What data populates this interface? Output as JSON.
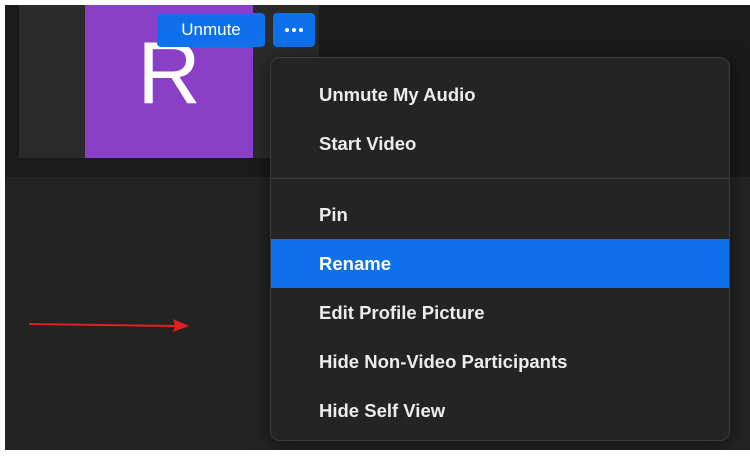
{
  "participant": {
    "initial": "R",
    "avatar_color": "#8a3fc7"
  },
  "toolbar": {
    "unmute_label": "Unmute",
    "more_icon": "more-horizontal-icon"
  },
  "context_menu": {
    "group1": [
      {
        "label": "Unmute My Audio"
      },
      {
        "label": "Start Video"
      }
    ],
    "group2": [
      {
        "label": "Pin"
      },
      {
        "label": "Rename",
        "highlighted": true
      },
      {
        "label": "Edit Profile Picture"
      },
      {
        "label": "Hide Non-Video Participants"
      },
      {
        "label": "Hide Self View"
      }
    ]
  },
  "annotation": {
    "arrow_icon": "red-arrow-icon",
    "arrow_color": "#e02020"
  },
  "colors": {
    "accent": "#0e71eb",
    "menu_bg": "#242424",
    "window_bg": "#232323"
  }
}
